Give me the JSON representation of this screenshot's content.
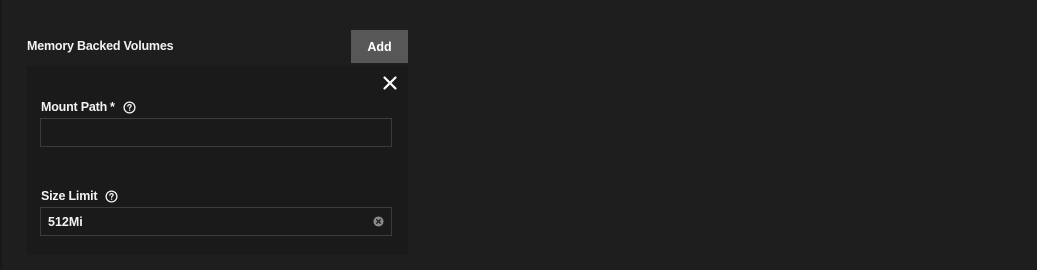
{
  "section": {
    "title": "Memory Backed Volumes",
    "add_label": "Add"
  },
  "form": {
    "mount_path": {
      "label": "Mount Path",
      "required_marker": "*",
      "value": ""
    },
    "size_limit": {
      "label": "Size Limit",
      "value": "512Mi"
    }
  },
  "icons": {
    "close": "close-icon",
    "help": "help-circle-icon",
    "clear": "clear-input-icon"
  },
  "colors": {
    "background": "#1e1e1e",
    "card_background": "#1a1a1a",
    "button_background": "#575757",
    "input_border": "#3c3c3c",
    "text": "#f2f2f2"
  }
}
